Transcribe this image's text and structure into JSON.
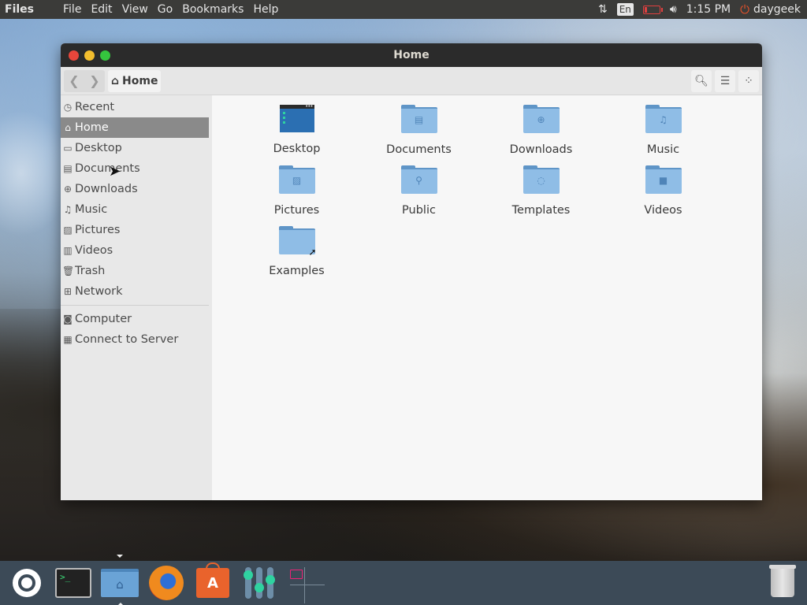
{
  "top_panel": {
    "app_name": "Files",
    "menu": [
      "File",
      "Edit",
      "View",
      "Go",
      "Bookmarks",
      "Help"
    ],
    "keyboard_layout": "En",
    "clock": "1:15 PM",
    "user": "daygeek",
    "battery_color": "#e04040"
  },
  "window": {
    "title": "Home",
    "breadcrumb": "Home"
  },
  "sidebar": {
    "items": [
      {
        "label": "Recent",
        "icon": "clock-icon"
      },
      {
        "label": "Home",
        "icon": "home-icon",
        "active": true
      },
      {
        "label": "Desktop",
        "icon": "folder-icon"
      },
      {
        "label": "Documents",
        "icon": "document-icon"
      },
      {
        "label": "Downloads",
        "icon": "download-icon"
      },
      {
        "label": "Music",
        "icon": "music-icon"
      },
      {
        "label": "Pictures",
        "icon": "picture-icon"
      },
      {
        "label": "Videos",
        "icon": "film-icon"
      },
      {
        "label": "Trash",
        "icon": "trash-icon"
      },
      {
        "label": "Network",
        "icon": "network-icon"
      }
    ],
    "devices": [
      {
        "label": "Computer",
        "icon": "computer-icon"
      },
      {
        "label": "Connect to Server",
        "icon": "server-icon"
      }
    ]
  },
  "files": [
    {
      "name": "Desktop",
      "type": "desktop"
    },
    {
      "name": "Documents",
      "glyph": "document-icon"
    },
    {
      "name": "Downloads",
      "glyph": "download-icon"
    },
    {
      "name": "Music",
      "glyph": "headphones-icon"
    },
    {
      "name": "Pictures",
      "glyph": "picture-icon"
    },
    {
      "name": "Public",
      "glyph": "share-icon"
    },
    {
      "name": "Templates",
      "glyph": "template-icon"
    },
    {
      "name": "Videos",
      "glyph": "camera-icon"
    },
    {
      "name": "Examples",
      "glyph": "symlink-icon"
    }
  ],
  "dock": {
    "items": [
      "ubuntu-logo-icon",
      "terminal-icon",
      "files-icon",
      "firefox-icon",
      "software-center-icon",
      "mixer-icon",
      "workspaces-icon"
    ],
    "trash": "trash-icon"
  },
  "colors": {
    "folder": "#8fbde6",
    "folder_dark": "#5f95c7",
    "active_sidebar": "#8a8a8a",
    "panel": "#3b3b39",
    "dock": "#3c4a57"
  }
}
